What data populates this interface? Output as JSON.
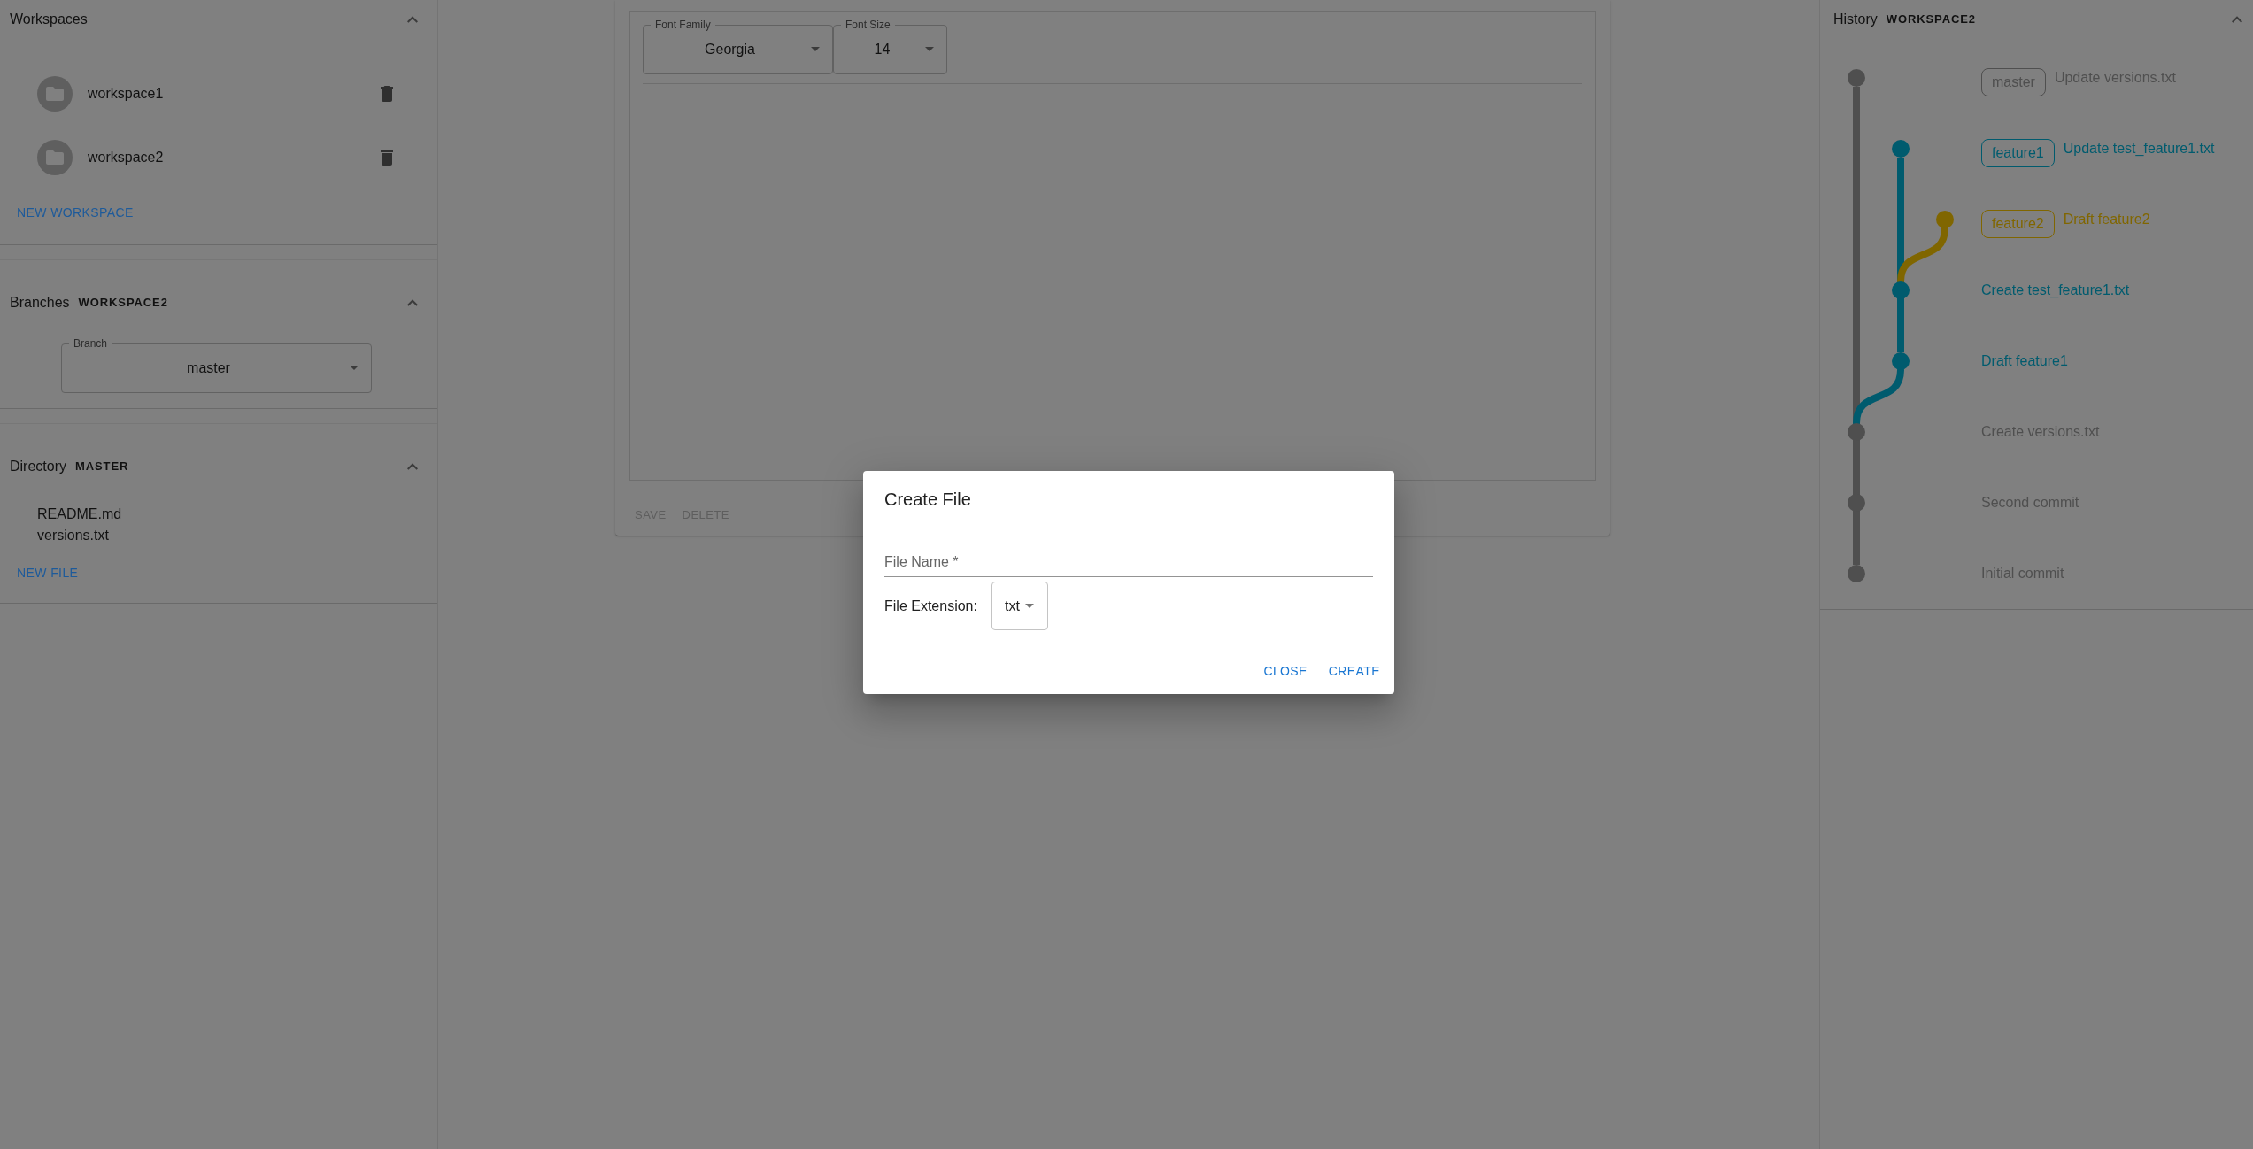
{
  "workspaces": {
    "title": "Workspaces",
    "expanded": true,
    "items": [
      {
        "name": "workspace1"
      },
      {
        "name": "workspace2"
      }
    ],
    "new_button": "NEW WORKSPACE"
  },
  "branches": {
    "title": "Branches",
    "subtitle": "WORKSPACE2",
    "expanded": true,
    "select": {
      "label": "Branch",
      "value": "master"
    }
  },
  "directory": {
    "title": "Directory",
    "subtitle": "MASTER",
    "expanded": true,
    "files": [
      "README.md",
      "versions.txt"
    ],
    "new_button": "NEW FILE"
  },
  "editor": {
    "selects": [
      {
        "label": "Font Family",
        "value": "Georgia"
      },
      {
        "label": "Font Size",
        "value": "14"
      }
    ],
    "buttons": [
      {
        "label": "SAVE",
        "disabled": true
      },
      {
        "label": "DELETE",
        "disabled": true
      }
    ]
  },
  "history": {
    "title": "History",
    "subtitle": "WORKSPACE2",
    "expanded": true,
    "commits": [
      {
        "message": "Update versions.txt",
        "tag": "master",
        "color": "#4f4f4f"
      },
      {
        "message": "Update test_feature1.txt",
        "tag": "feature1",
        "color": "#005b6e"
      },
      {
        "message": "Draft feature2",
        "tag": "feature2",
        "color": "#806600"
      },
      {
        "message": "Create test_feature1.txt",
        "color": "#005b6e"
      },
      {
        "message": "Draft feature1",
        "color": "#005b6e"
      },
      {
        "message": "Create versions.txt",
        "color": "#4f4f4f"
      },
      {
        "message": "Second commit",
        "color": "#4f4f4f"
      },
      {
        "message": "Initial commit",
        "color": "#4f4f4f"
      }
    ]
  },
  "dialog": {
    "title": "Create File",
    "file_name": {
      "placeholder": "File Name *"
    },
    "extension": {
      "label": "File Extension:",
      "value": "txt"
    },
    "buttons": [
      {
        "label": "CLOSE"
      },
      {
        "label": "CREATE"
      }
    ]
  }
}
